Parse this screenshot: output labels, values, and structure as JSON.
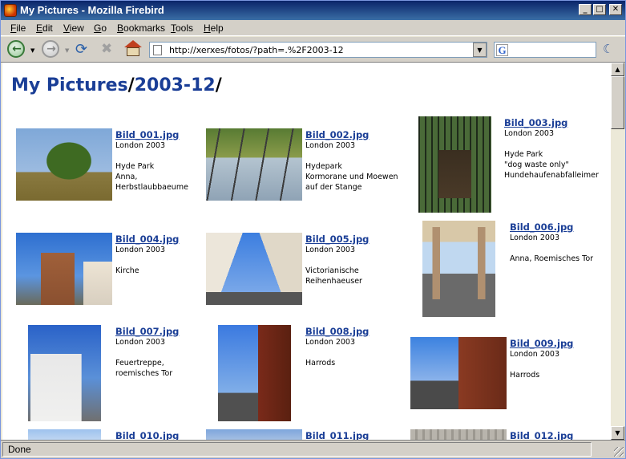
{
  "window": {
    "title": "My Pictures - Mozilla Firebird",
    "controls": {
      "minimize": "0",
      "maximize": "1",
      "close": "r"
    }
  },
  "menu": [
    "File",
    "Edit",
    "View",
    "Go",
    "Bookmarks",
    "Tools",
    "Help"
  ],
  "toolbar": {
    "url": "http://xerxes/fotos/?path=.%2F2003-12",
    "search_placeholder": ""
  },
  "page": {
    "breadcrumb": {
      "root": "My Pictures",
      "sep1": "/",
      "folder": "2003-12",
      "sep2": "/"
    },
    "photos": [
      {
        "file": "Bild_001.jpg",
        "lines": [
          "London 2003",
          "",
          "Hyde Park",
          "Anna,",
          "Herbstlaubbaeume"
        ]
      },
      {
        "file": "Bild_002.jpg",
        "lines": [
          "London 2003",
          "",
          "Hydepark",
          "Kormorane und Moewen",
          "auf der Stange"
        ]
      },
      {
        "file": "Bild_003.jpg",
        "lines": [
          "London 2003",
          "",
          "Hyde Park",
          "\"dog waste only\"",
          "Hundehaufenabfalleimer"
        ]
      },
      {
        "file": "Bild_004.jpg",
        "lines": [
          "London 2003",
          "",
          "Kirche"
        ]
      },
      {
        "file": "Bild_005.jpg",
        "lines": [
          "London 2003",
          "",
          "Victorianische",
          "Reihenhaeuser"
        ]
      },
      {
        "file": "Bild_006.jpg",
        "lines": [
          "London 2003",
          "",
          "Anna, Roemisches Tor"
        ]
      },
      {
        "file": "Bild_007.jpg",
        "lines": [
          "London 2003",
          "",
          "Feuertreppe,",
          "roemisches Tor"
        ]
      },
      {
        "file": "Bild_008.jpg",
        "lines": [
          "London 2003",
          "",
          "Harrods"
        ]
      },
      {
        "file": "Bild_009.jpg",
        "lines": [
          "London 2003",
          "",
          "Harrods"
        ]
      },
      {
        "file": "Bild_010.jpg",
        "lines": []
      },
      {
        "file": "Bild_011.jpg",
        "lines": []
      },
      {
        "file": "Bild_012.jpg",
        "lines": []
      }
    ]
  },
  "status": {
    "text": "Done"
  }
}
